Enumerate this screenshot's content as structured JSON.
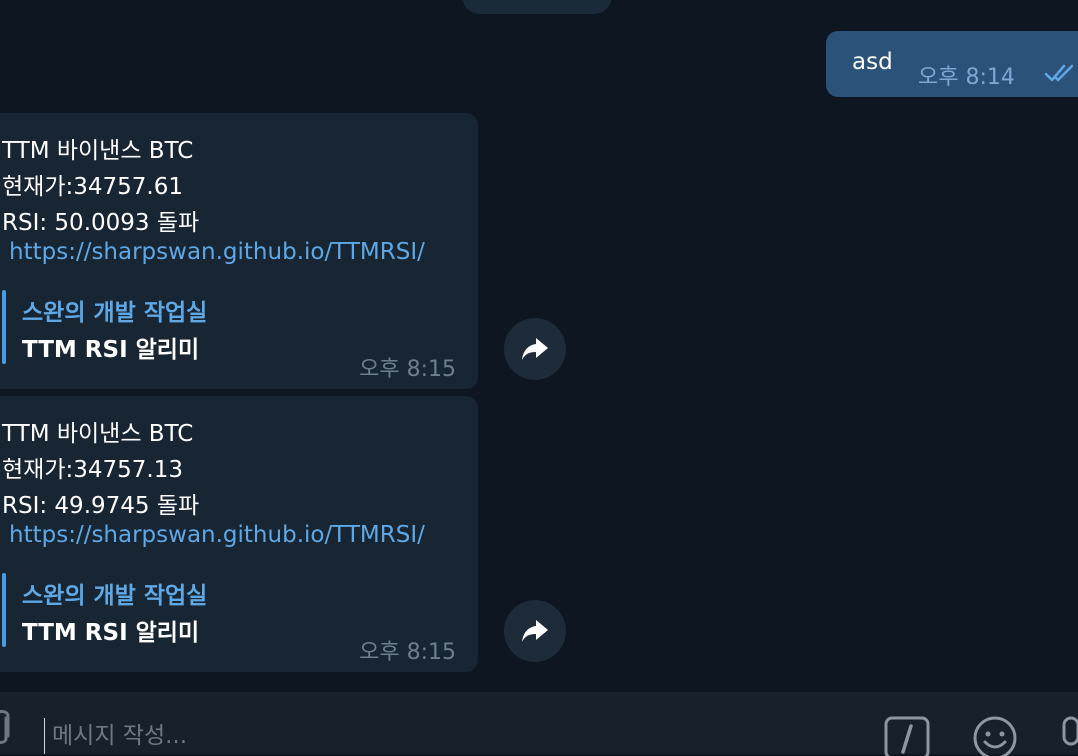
{
  "outgoing": {
    "text": "asd",
    "time": "오후 8:14"
  },
  "incoming": [
    {
      "lines": [
        "TTM 바이낸스 BTC",
        " 현재가:34757.61",
        " RSI: 50.0093 돌파"
      ],
      "link": "https://sharpswan.github.io/TTMRSI/",
      "preview_site": "스완의 개발 작업실",
      "preview_title": "TTM RSI 알리미",
      "time": "오후 8:15"
    },
    {
      "lines": [
        "TTM 바이낸스 BTC",
        " 현재가:34757.13",
        " RSI: 49.9745 돌파"
      ],
      "link": "https://sharpswan.github.io/TTMRSI/",
      "preview_site": "스완의 개발 작업실",
      "preview_title": "TTM RSI 알리미",
      "time": "오후 8:15"
    }
  ],
  "composer": {
    "placeholder": "메시지 작성..."
  },
  "colors": {
    "background": "#0e1621",
    "incoming_bubble": "#182533",
    "outgoing_bubble": "#2b5278",
    "link": "#5fa8e6",
    "accent": "#4a9be0"
  },
  "icons": {
    "attach": "paperclip-icon",
    "forward": "forward-arrow-icon",
    "read_status": "double-check-icon",
    "commands": "slash-command-icon",
    "emoji": "smile-icon",
    "voice": "microphone-icon"
  }
}
